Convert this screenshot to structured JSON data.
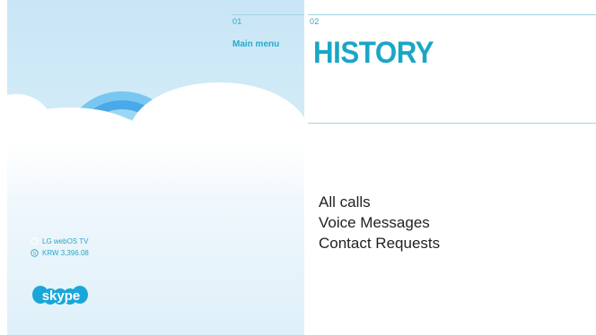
{
  "nav": {
    "tab1": {
      "number": "01",
      "title": "Main menu"
    },
    "tab2": {
      "number": "02"
    }
  },
  "page": {
    "title": "HISTORY"
  },
  "menu": {
    "items": [
      {
        "label": "All calls"
      },
      {
        "label": "Voice Messages"
      },
      {
        "label": "Contact Requests"
      }
    ]
  },
  "status": {
    "device": {
      "icon": "circle-icon",
      "label": "LG webOS TV"
    },
    "credit": {
      "icon": "skype-credit-icon",
      "label": "KRW 3,396.08"
    }
  },
  "brand": {
    "logo": "skype-logo",
    "logo_text": "skype"
  },
  "colors": {
    "accent": "#1aa6c6",
    "sky": "#c9e6f6",
    "rainbow_outer": "#4ab1ea",
    "rainbow_inner": "#9cd6f5",
    "text": "#222222"
  }
}
